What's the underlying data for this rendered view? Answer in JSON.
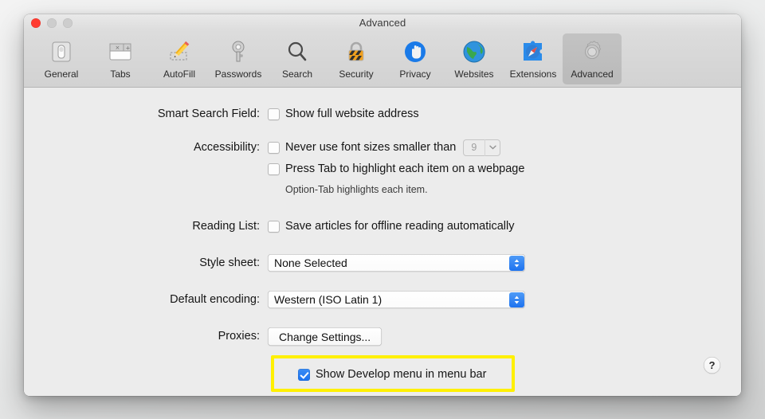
{
  "window": {
    "title": "Advanced",
    "traffic_lights": [
      "close",
      "minimize",
      "maximize"
    ]
  },
  "toolbar": {
    "items": [
      {
        "label": "General",
        "icon": "general-icon",
        "selected": false
      },
      {
        "label": "Tabs",
        "icon": "tabs-icon",
        "selected": false
      },
      {
        "label": "AutoFill",
        "icon": "autofill-icon",
        "selected": false
      },
      {
        "label": "Passwords",
        "icon": "passwords-icon",
        "selected": false
      },
      {
        "label": "Search",
        "icon": "search-icon",
        "selected": false
      },
      {
        "label": "Security",
        "icon": "security-icon",
        "selected": false
      },
      {
        "label": "Privacy",
        "icon": "privacy-icon",
        "selected": false
      },
      {
        "label": "Websites",
        "icon": "websites-icon",
        "selected": false
      },
      {
        "label": "Extensions",
        "icon": "extensions-icon",
        "selected": false
      },
      {
        "label": "Advanced",
        "icon": "advanced-icon",
        "selected": true
      }
    ]
  },
  "settings": {
    "smart_search_field": {
      "label": "Smart Search Field:",
      "checkbox_label": "Show full website address",
      "checked": false
    },
    "accessibility": {
      "label": "Accessibility:",
      "never_use_font_label": "Never use font sizes smaller than",
      "never_use_font_checked": false,
      "font_size_value": "9",
      "press_tab_label": "Press Tab to highlight each item on a webpage",
      "press_tab_checked": false,
      "note": "Option-Tab highlights each item."
    },
    "reading_list": {
      "label": "Reading List:",
      "checkbox_label": "Save articles for offline reading automatically",
      "checked": false
    },
    "style_sheet": {
      "label": "Style sheet:",
      "value": "None Selected"
    },
    "default_encoding": {
      "label": "Default encoding:",
      "value": "Western (ISO Latin 1)"
    },
    "proxies": {
      "label": "Proxies:",
      "button_label": "Change Settings..."
    },
    "develop_menu": {
      "checkbox_label": "Show Develop menu in menu bar",
      "checked": true,
      "highlighted": true,
      "highlight_color": "#fff000"
    }
  },
  "help": {
    "label": "?"
  },
  "colors": {
    "accent_blue": "#1d72ef",
    "window_bg": "#ececec",
    "toolbar_bg": "#d6d6d6",
    "highlight_yellow": "#fff000"
  }
}
